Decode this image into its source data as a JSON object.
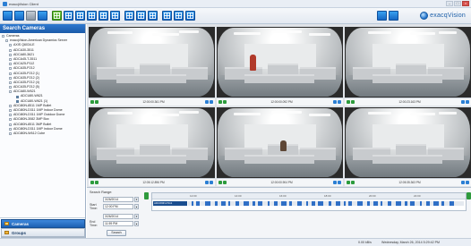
{
  "window": {
    "title": "exacqVision Client"
  },
  "brand": {
    "name": "exacqVision"
  },
  "sidebar": {
    "header": "Search Cameras",
    "tree": [
      {
        "label": "Cameras",
        "level": 0
      },
      {
        "label": "exacqVision-American Dynamics Server",
        "level": 1
      },
      {
        "label": "AXIS Q6034-E",
        "level": 2
      },
      {
        "label": "ADCA30-3511",
        "level": 2
      },
      {
        "label": "ADCA80-3621",
        "level": 2
      },
      {
        "label": "ADCA45-T-3511",
        "level": 2
      },
      {
        "label": "ADCA25-P112",
        "level": 2
      },
      {
        "label": "ADCA35-P212",
        "level": 2
      },
      {
        "label": "ADCA35-P212 (1)",
        "level": 2
      },
      {
        "label": "ADCA35-P212 (2)",
        "level": 2
      },
      {
        "label": "ADCA35-P212 (4)",
        "level": 2
      },
      {
        "label": "ADCA35-P212 (5)",
        "level": 2
      },
      {
        "label": "ADCA80-W621",
        "level": 2
      },
      {
        "label": "ADCU80-W621",
        "level": 3
      },
      {
        "label": "ADCU80-W621 (1)",
        "level": 3
      },
      {
        "label": "ADCi80N-8511 1MP Bullet",
        "level": 2
      },
      {
        "label": "ADCi80N-D311 1MP Indoor Dome",
        "level": 2
      },
      {
        "label": "ADCi80N-D311 1MP Outdoor Dome",
        "level": 2
      },
      {
        "label": "ADCi80N-3082 3MP Box",
        "level": 2
      },
      {
        "label": "ADCi80N-8511 3MP Bullet",
        "level": 2
      },
      {
        "label": "ADCi80N-D311 1MP Indoor Dome",
        "level": 2
      },
      {
        "label": "ADCi80N-W612 Cube",
        "level": 2
      }
    ],
    "nav": [
      {
        "label": "Cameras",
        "active": true
      },
      {
        "label": "Groups",
        "active": false
      },
      {
        "label": "Maps",
        "active": false
      }
    ]
  },
  "videos": [
    {
      "timestamp": "12:00:00.361 PM"
    },
    {
      "timestamp": "12:00:00.092 PM"
    },
    {
      "timestamp": "12:00:23.163 PM"
    },
    {
      "timestamp": "12:05:12.896 PM"
    },
    {
      "timestamp": "12:00:00.904 PM"
    },
    {
      "timestamp": "12:05:35.363 PM"
    }
  ],
  "search": {
    "range_label": "Search Range:",
    "start_date": "3/26/2014",
    "start_time_label": "Start Time:",
    "start_time": "12:00 PM",
    "end_date": "3/26/2014",
    "end_time_label": "End Time:",
    "end_time": "11:59 PM",
    "search_button": "Search"
  },
  "timeline": {
    "camera_label": "ADCI80N-P111",
    "ticks": [
      "12:00",
      "14:00",
      "16:00",
      "18:00",
      "20:00",
      "22:00"
    ]
  },
  "status": {
    "rate": "0.00 kB/s",
    "datetime": "Wednesday, March 26, 2014 5:29:42 PM"
  },
  "colors": {
    "accent": "#1b5aa8",
    "record": "#2f6fc6",
    "ok": "#2c9b3c"
  }
}
